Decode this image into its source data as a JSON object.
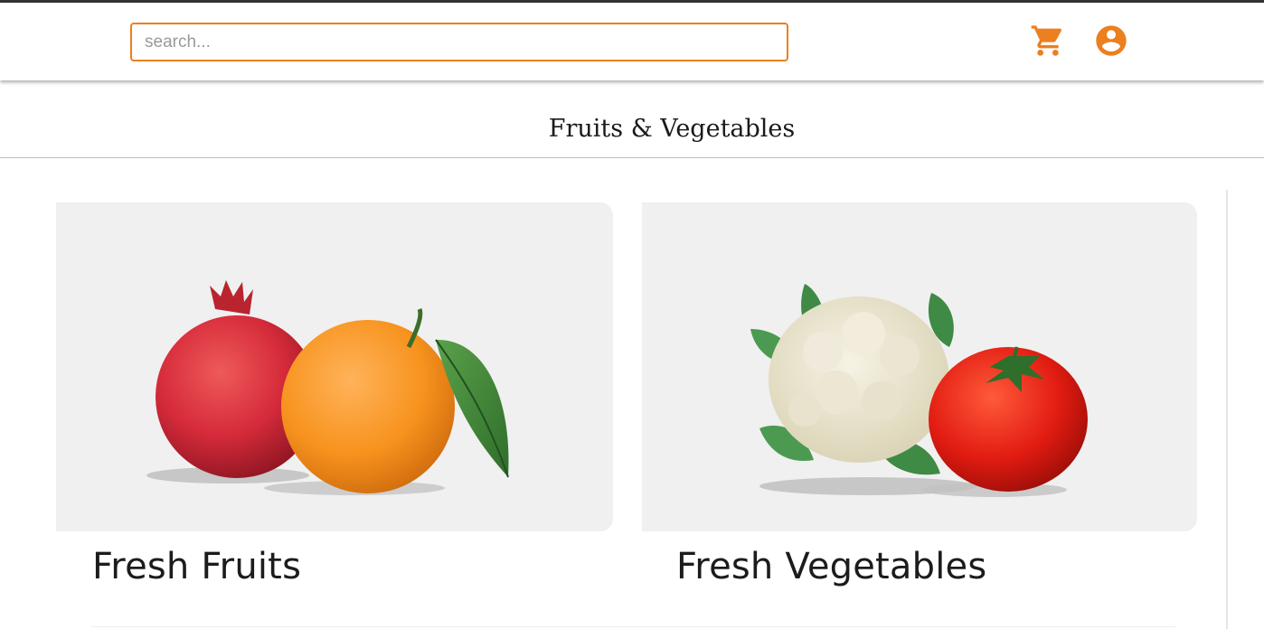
{
  "header": {
    "search": {
      "placeholder": "search...",
      "value": ""
    },
    "icons": [
      "cart-icon",
      "account-circle-icon"
    ],
    "accent_color": "#ec7f1f"
  },
  "page": {
    "title": "Fruits & Vegetables"
  },
  "categories": [
    {
      "label": "Fresh Fruits",
      "image": "pomegranate-and-orange"
    },
    {
      "label": "Fresh Vegetables",
      "image": "cauliflower-and-tomato"
    }
  ]
}
